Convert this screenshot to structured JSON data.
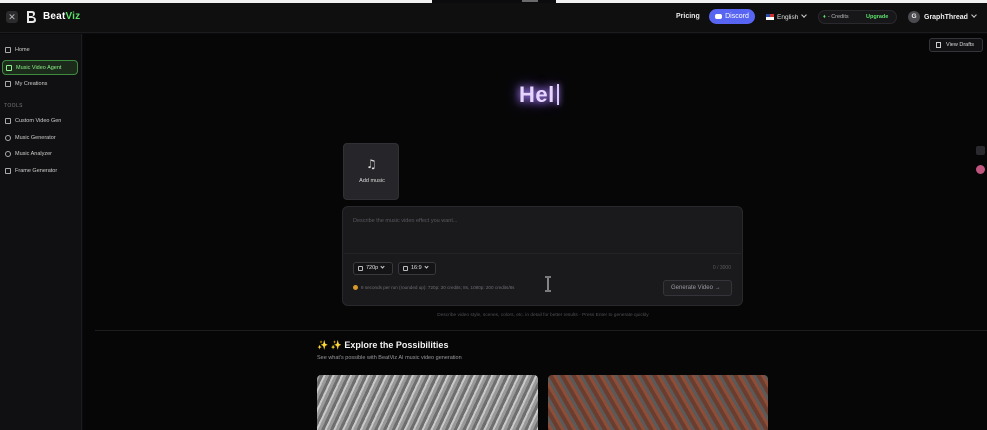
{
  "header": {
    "brand_prefix": "Beat",
    "brand_suffix": "Viz",
    "nav_pricing": "Pricing",
    "discord_label": "Discord",
    "language_label": "English",
    "credits_label": "Credits",
    "credits_value": "-",
    "upgrade_label": "Upgrade",
    "user_initial": "G",
    "user_name": "GraphThread"
  },
  "sidebar": {
    "items": [
      {
        "label": "Home",
        "icon": "home-icon"
      },
      {
        "label": "Music Video Agent",
        "icon": "sparkle-icon"
      },
      {
        "label": "My Creations",
        "icon": "grid-icon"
      }
    ],
    "tools_heading": "TOOLS",
    "tools": [
      {
        "label": "Custom Video Gen",
        "icon": "video-icon"
      },
      {
        "label": "Music Generator",
        "icon": "music-note-icon"
      },
      {
        "label": "Music Analyzer",
        "icon": "music-note-icon"
      },
      {
        "label": "Frame Generator",
        "icon": "frame-icon"
      }
    ]
  },
  "main": {
    "view_drafts": "View Drafts",
    "hero_text": "Hel",
    "add_music_label": "Add music",
    "prompt_placeholder": "Describe the music video effect you want...",
    "resolution": "720p",
    "aspect_ratio": "16:9",
    "char_counter": "0 / 3000",
    "pricing_info": "8 seconds per run (rounded up): 720p: 30 credits; 8s, 1080p: 200 credits/8s",
    "generate_label": "Generate Video →",
    "hint_text": "Describe video style, scenes, colors, etc. in detail for better results · Press Enter to generate quickly",
    "explore_title": "✨ ✨ Explore the Possibilities",
    "explore_subtitle": "See what's possible with BeatViz AI music video generation"
  },
  "colors": {
    "accent_green": "#5ee06a",
    "discord": "#5865f2",
    "hero_glow": "#b38cff",
    "background": "#060607"
  }
}
